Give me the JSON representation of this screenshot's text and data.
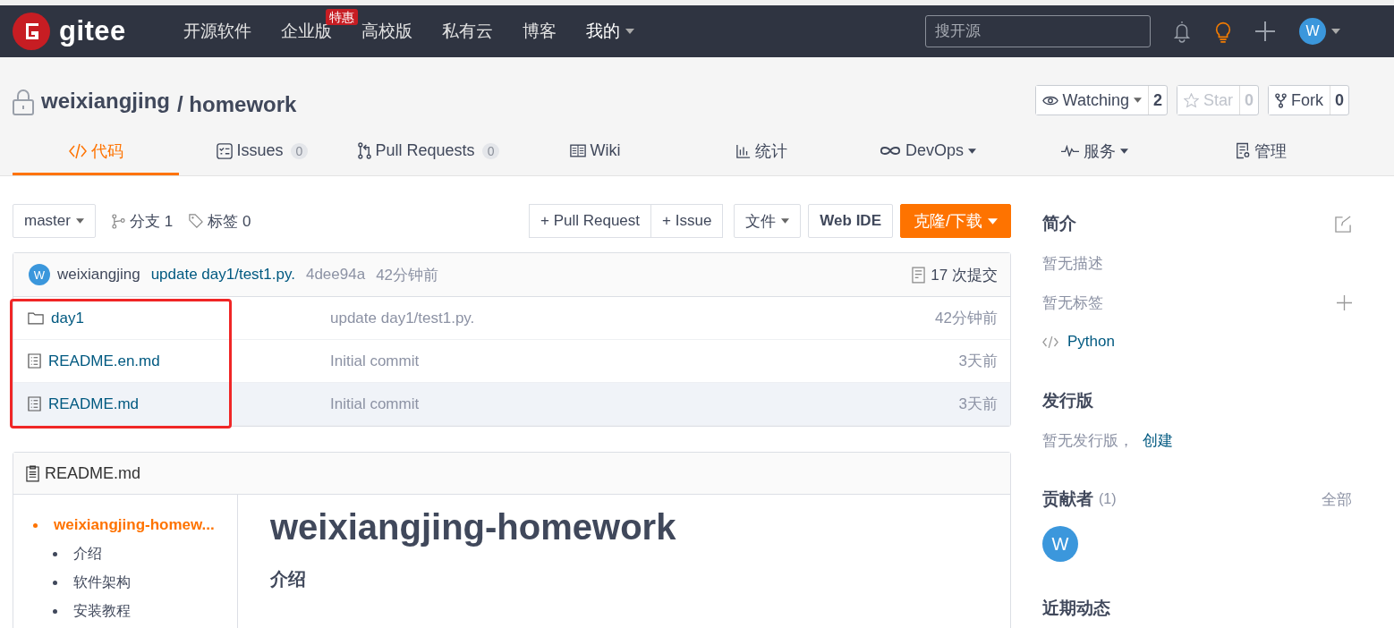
{
  "navbar": {
    "logo": "gitee",
    "items": [
      {
        "label": "开源软件",
        "dropdown": false
      },
      {
        "label": "企业版",
        "badge": "特惠",
        "dropdown": false
      },
      {
        "label": "高校版",
        "dropdown": false
      },
      {
        "label": "私有云",
        "dropdown": false
      },
      {
        "label": "博客",
        "dropdown": false
      },
      {
        "label": "我的",
        "dropdown": true
      }
    ],
    "search": {
      "placeholder": "搜开源"
    },
    "avatar": "W"
  },
  "repo": {
    "owner": "weixiangjing",
    "name": "/ homework",
    "private": true,
    "actions": [
      {
        "kind": "watch",
        "label": "Watching",
        "count": "2",
        "disabled": false
      },
      {
        "kind": "star",
        "label": "Star",
        "count": "0",
        "disabled": true
      },
      {
        "kind": "fork",
        "label": "Fork",
        "count": "0",
        "disabled": false
      }
    ]
  },
  "tabs": [
    {
      "kind": "code",
      "label": "代码",
      "dropdown": false,
      "selected": true
    },
    {
      "kind": "issues",
      "label": "Issues",
      "count": "0",
      "dropdown": false,
      "selected": false
    },
    {
      "kind": "pr",
      "label": "Pull Requests",
      "count": "0",
      "dropdown": false,
      "selected": false
    },
    {
      "kind": "wiki",
      "label": "Wiki",
      "dropdown": false,
      "selected": false
    },
    {
      "kind": "stats",
      "label": "统计",
      "dropdown": false,
      "selected": false
    },
    {
      "kind": "devops",
      "label": "DevOps",
      "dropdown": true,
      "selected": false
    },
    {
      "kind": "service",
      "label": "服务",
      "dropdown": true,
      "selected": false
    },
    {
      "kind": "manage",
      "label": "管理",
      "dropdown": false,
      "selected": false
    }
  ],
  "toolbar": {
    "branch": "master",
    "branches": "分支 1",
    "tags": "标签 0",
    "buttons": [
      "+ Pull Request",
      "+ Issue"
    ],
    "file_menu": "文件",
    "web_ide": "Web IDE",
    "clone": "克隆/下载"
  },
  "last_commit": {
    "avatar": "W",
    "author": "weixiangjing",
    "message": "update day1/test1.py.",
    "hash": "4dee94a",
    "time": "42分钟前",
    "commits": "17 次提交"
  },
  "files": {
    "highlight_names": true,
    "items": [
      {
        "kind": "folder",
        "name": "day1",
        "message": "update day1/test1.py.",
        "time": "42分钟前",
        "hovered": false
      },
      {
        "kind": "file",
        "name": "README.en.md",
        "message": "Initial commit",
        "time": "3天前",
        "hovered": false
      },
      {
        "kind": "file",
        "name": "README.md",
        "message": "Initial commit",
        "time": "3天前",
        "hovered": true
      }
    ]
  },
  "readme": {
    "title": "README.md",
    "toc": [
      {
        "label": "weixiangjing-homew...",
        "selected": true,
        "children": [
          {
            "label": "介绍",
            "selected": false
          },
          {
            "label": "软件架构",
            "selected": false
          },
          {
            "label": "安装教程",
            "selected": false
          }
        ]
      }
    ],
    "heading": "weixiangjing-homework",
    "subheading": "介绍"
  },
  "sidebar": {
    "about_title": "简介",
    "description": "暂无描述",
    "tags": "暂无标签",
    "language": "Python",
    "releases_title": "发行版",
    "releases_text": "暂无发行版，",
    "releases_link": "创建",
    "contributors_title": "贡献者",
    "contributors_count": "(1)",
    "contributors_all": "全部",
    "contributors": [
      "W"
    ],
    "activity_title": "近期动态"
  }
}
